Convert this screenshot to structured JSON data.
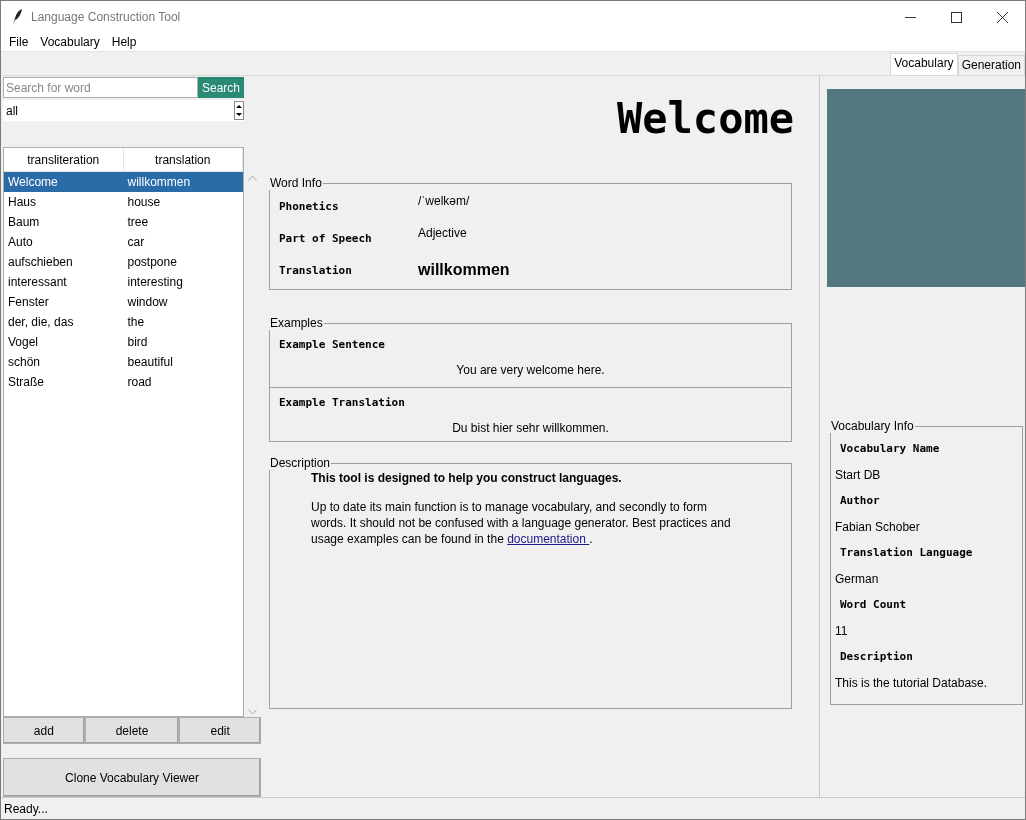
{
  "window": {
    "title": "Language Construction Tool"
  },
  "menu": [
    "File",
    "Vocabulary",
    "Help"
  ],
  "tabs": [
    {
      "label": "Vocabulary",
      "selected": true
    },
    {
      "label": "Generation",
      "selected": false
    }
  ],
  "search": {
    "placeholder": "Search for word",
    "button": "Search"
  },
  "filter": {
    "value": "all"
  },
  "table": {
    "columns": [
      "transliteration",
      "translation"
    ],
    "rows": [
      {
        "cells": [
          "Welcome",
          "willkommen"
        ],
        "selected": true
      },
      {
        "cells": [
          "Haus",
          "house"
        ],
        "selected": false
      },
      {
        "cells": [
          "Baum",
          "tree"
        ],
        "selected": false
      },
      {
        "cells": [
          "Auto",
          "car"
        ],
        "selected": false
      },
      {
        "cells": [
          "aufschieben",
          "postpone"
        ],
        "selected": false
      },
      {
        "cells": [
          "interessant",
          "interesting"
        ],
        "selected": false
      },
      {
        "cells": [
          "Fenster",
          "window"
        ],
        "selected": false
      },
      {
        "cells": [
          "der, die, das",
          "the"
        ],
        "selected": false
      },
      {
        "cells": [
          "Vogel",
          "bird"
        ],
        "selected": false
      },
      {
        "cells": [
          "schön",
          "beautiful"
        ],
        "selected": false
      },
      {
        "cells": [
          "Straße",
          "road"
        ],
        "selected": false
      }
    ]
  },
  "list_buttons": [
    "add",
    "delete",
    "edit"
  ],
  "clone_button": "Clone Vocabulary Viewer",
  "heading": "Welcome",
  "word_info": {
    "title": "Word Info",
    "fields": [
      {
        "label": "Phonetics",
        "value": "/ˈwelkəm/",
        "kind": "plain"
      },
      {
        "label": "Part of Speech",
        "value": "Adjective",
        "kind": "plain"
      },
      {
        "label": "Translation",
        "value": "willkommen",
        "kind": "emphasis"
      }
    ]
  },
  "examples": {
    "title": "Examples",
    "items": [
      {
        "label": "Example Sentence",
        "value": "You are very welcome here."
      },
      {
        "label": "Example Translation",
        "value": "Du bist hier sehr willkommen."
      }
    ]
  },
  "description": {
    "title": "Description",
    "heading": "This tool is designed to help you construct languages.",
    "body": "Up to date its main function is to manage vocabulary, and secondly to form words. It should not be confused with a language generator. Best practices and usage examples can be found in the",
    "link": "documentation ",
    "after": "."
  },
  "vocabulary_info": {
    "title": "Vocabulary Info",
    "fields": [
      {
        "label": "Vocabulary Name",
        "value": "Start DB"
      },
      {
        "label": "Author",
        "value": "Fabian Schober"
      },
      {
        "label": "Translation Language",
        "value": "German"
      },
      {
        "label": "Word Count",
        "value": "11"
      },
      {
        "label": "Description",
        "value": "This is the tutorial Database."
      }
    ]
  },
  "status_bar": "Ready..."
}
